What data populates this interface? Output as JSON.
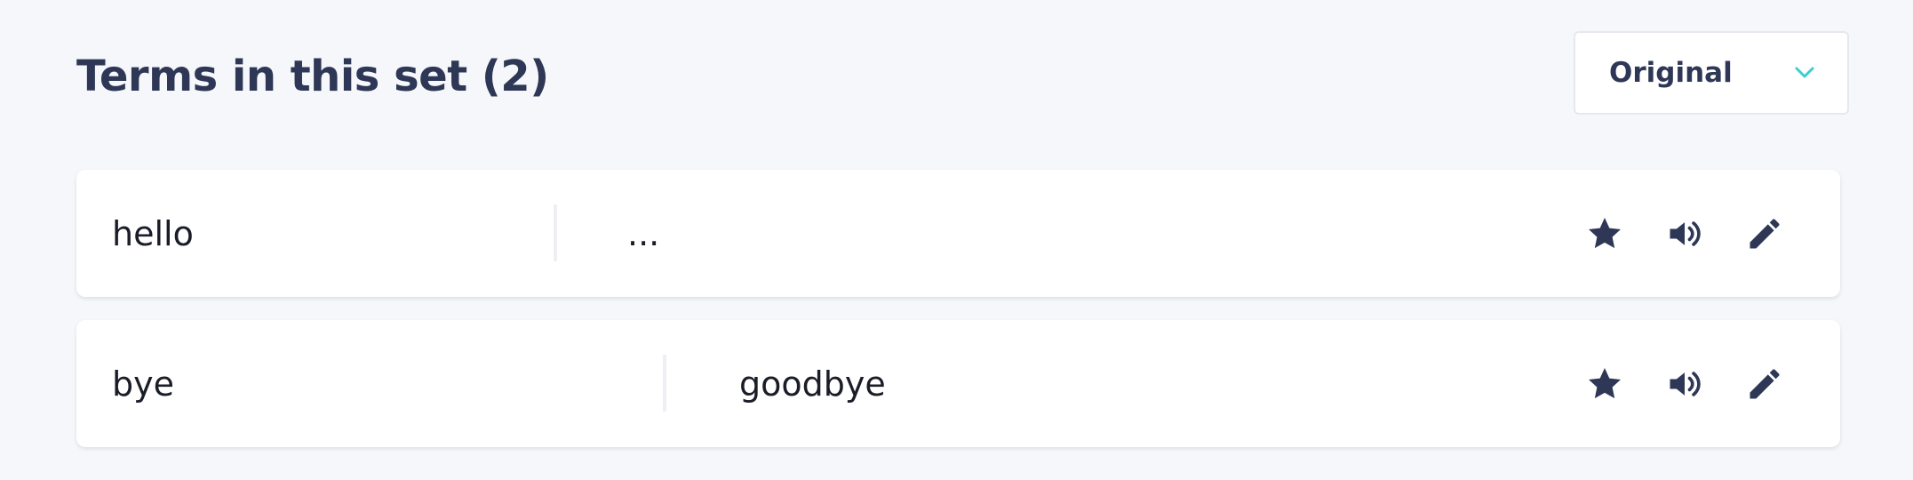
{
  "header": {
    "title": "Terms in this set (2)"
  },
  "sort": {
    "selected": "Original"
  },
  "terms": [
    {
      "term": "hello",
      "definition": "..."
    },
    {
      "term": "bye",
      "definition": "goodbye"
    }
  ],
  "icons": {
    "star": "star-icon",
    "audio": "speaker-icon",
    "edit": "pencil-icon",
    "dropdown": "chevron-down-icon"
  },
  "colors": {
    "text": "#2e3856",
    "accent": "#3ccfcf",
    "background": "#f6f7fb"
  }
}
